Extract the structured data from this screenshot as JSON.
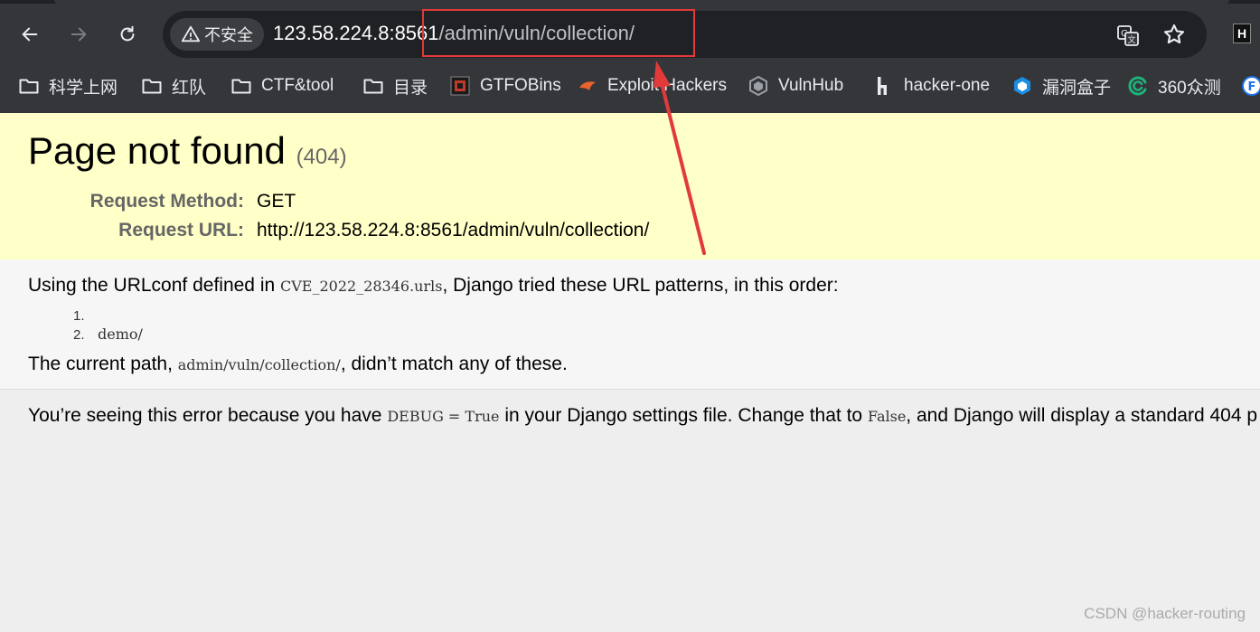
{
  "browser": {
    "security_label": "不安全",
    "url_host": "123.58.224.8:8561",
    "url_path": "/admin/vuln/collection/",
    "extension_label": "H",
    "bookmarks": [
      {
        "label": "科学上网",
        "icon": "folder-icon"
      },
      {
        "label": "红队",
        "icon": "folder-icon"
      },
      {
        "label": "CTF&tool",
        "icon": "folder-icon"
      },
      {
        "label": "目录",
        "icon": "folder-icon"
      },
      {
        "label": "GTFOBins",
        "icon": "gtfobins-icon"
      },
      {
        "label": "Exploit Hackers",
        "icon": "exploit-icon"
      },
      {
        "label": "VulnHub",
        "icon": "vulnhub-icon"
      },
      {
        "label": "hacker-one",
        "icon": "hackerone-icon"
      },
      {
        "label": "漏洞盒子",
        "icon": "vulbox-icon"
      },
      {
        "label": "360众测",
        "icon": "360-icon"
      }
    ]
  },
  "error": {
    "title": "Page not found",
    "code": "(404)",
    "request_method_label": "Request Method:",
    "request_method": "GET",
    "request_url_label": "Request URL:",
    "request_url": "http://123.58.224.8:8561/admin/vuln/collection/"
  },
  "info": {
    "intro_prefix": "Using the URLconf defined in ",
    "urlconf": "CVE_2022_28346.urls",
    "intro_suffix": ", Django tried these URL patterns, in this order:",
    "patterns": [
      {
        "num": "1.",
        "pattern": ""
      },
      {
        "num": "2.",
        "pattern": "demo/"
      }
    ],
    "current_prefix": "The current path, ",
    "current_path": "admin/vuln/collection/",
    "current_suffix": ", didn’t match any of these."
  },
  "explanation": {
    "prefix": "You’re seeing this error because you have ",
    "debug_code": "DEBUG = True",
    "middle": " in your Django settings file. Change that to ",
    "false_code": "False",
    "suffix": ", and Django will display a standard 404 p"
  },
  "watermark": "CSDN @hacker-routing",
  "colors": {
    "chrome_bg": "#35363a",
    "omnibox_bg": "#202124",
    "summary_bg": "#ffffc8",
    "annotation_red": "#e23a3a"
  }
}
